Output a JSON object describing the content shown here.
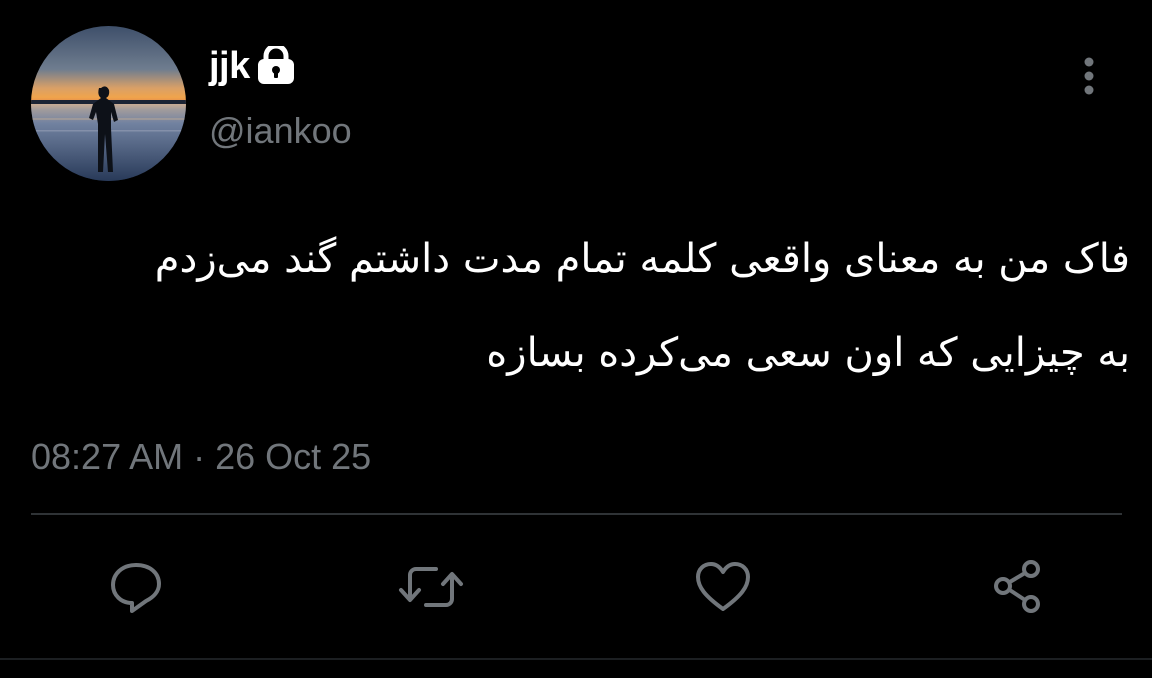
{
  "tweet": {
    "display_name": "jjk",
    "handle": "@iankoo",
    "body_lines": [
      "فاک من به معنای واقعی کلمه تمام مدت داشتم گند می‌زدم",
      "به چیزایی که اون سعی می‌کرده بسازه"
    ],
    "timestamp": "08:27 AM · 26 Oct 25",
    "avatar_icon": "sunset-silhouette-avatar",
    "badge_icon": "lock-icon"
  },
  "actions": {
    "reply_icon": "reply-icon",
    "retweet_icon": "retweet-icon",
    "like_icon": "heart-icon",
    "share_icon": "share-icon",
    "more_icon": "more-vertical-icon"
  },
  "colors": {
    "background": "#000000",
    "text_primary": "#ffffff",
    "text_secondary": "#71767b",
    "divider": "#2f3336",
    "icon": "#71767b"
  }
}
